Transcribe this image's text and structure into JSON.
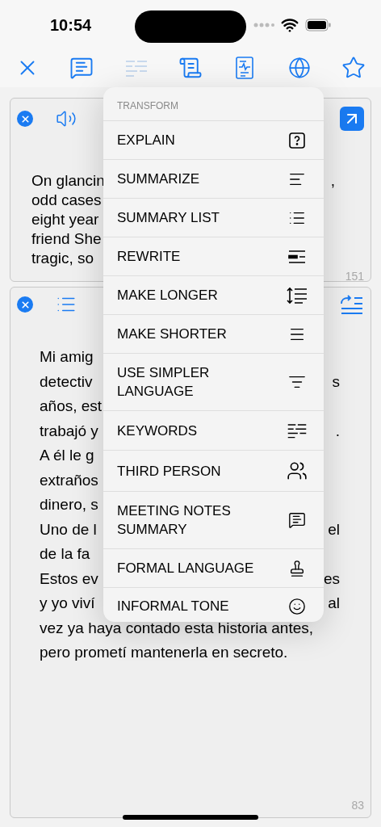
{
  "status_bar": {
    "time": "10:54"
  },
  "toolbar": {
    "items": [
      {
        "kind": "close",
        "disabled": false
      },
      {
        "kind": "chat",
        "disabled": false
      },
      {
        "kind": "lines",
        "disabled": true
      },
      {
        "kind": "scroll",
        "disabled": false
      },
      {
        "kind": "report",
        "disabled": false
      },
      {
        "kind": "globe",
        "disabled": false
      },
      {
        "kind": "star",
        "disabled": false
      }
    ]
  },
  "source_card": {
    "lines": [
      {
        "left": "On glancin",
        "right": ","
      },
      {
        "left": "odd cases"
      },
      {
        "left": "eight year"
      },
      {
        "left": "friend She"
      },
      {
        "left": "tragic, so"
      }
    ],
    "count": "151"
  },
  "result_card": {
    "lines": [
      {
        "left": "Mi amig"
      },
      {
        "left": "detectiv",
        "right": "s"
      },
      {
        "left": "años, est"
      },
      {
        "left": "trabajó y",
        "right": "."
      },
      {
        "left": "A él le g"
      },
      {
        "left": "extraños"
      },
      {
        "left": "dinero, s"
      },
      {
        "left": "Uno de l",
        "right": "el"
      },
      {
        "left": "de la fa"
      },
      {
        "left": "Estos ev",
        "right": "es"
      },
      {
        "left": "y yo viví",
        "right": "al"
      },
      {
        "left": "vez ya haya contado esta historia antes,"
      },
      {
        "left": "pero prometí mantenerla en secreto."
      }
    ],
    "count": "83"
  },
  "menu": {
    "title": "TRANSFORM",
    "items": [
      {
        "label": "EXPLAIN",
        "kind": "question"
      },
      {
        "label": "SUMMARIZE",
        "kind": "align"
      },
      {
        "label": "SUMMARY LIST",
        "kind": "list"
      },
      {
        "label": "REWRITE",
        "kind": "rewrite"
      },
      {
        "label": "MAKE LONGER",
        "kind": "longer"
      },
      {
        "label": "MAKE SHORTER",
        "kind": "shorter"
      },
      {
        "label": "USE SIMPLER LANGUAGE",
        "kind": "simpler"
      },
      {
        "label": "KEYWORDS",
        "kind": "keywords"
      },
      {
        "label": "THIRD PERSON",
        "kind": "people"
      },
      {
        "label": "MEETING NOTES SUMMARY",
        "kind": "chat"
      },
      {
        "label": "FORMAL LANGUAGE",
        "kind": "stamp"
      },
      {
        "label": "INFORMAL TONE",
        "kind": "smile"
      }
    ]
  }
}
